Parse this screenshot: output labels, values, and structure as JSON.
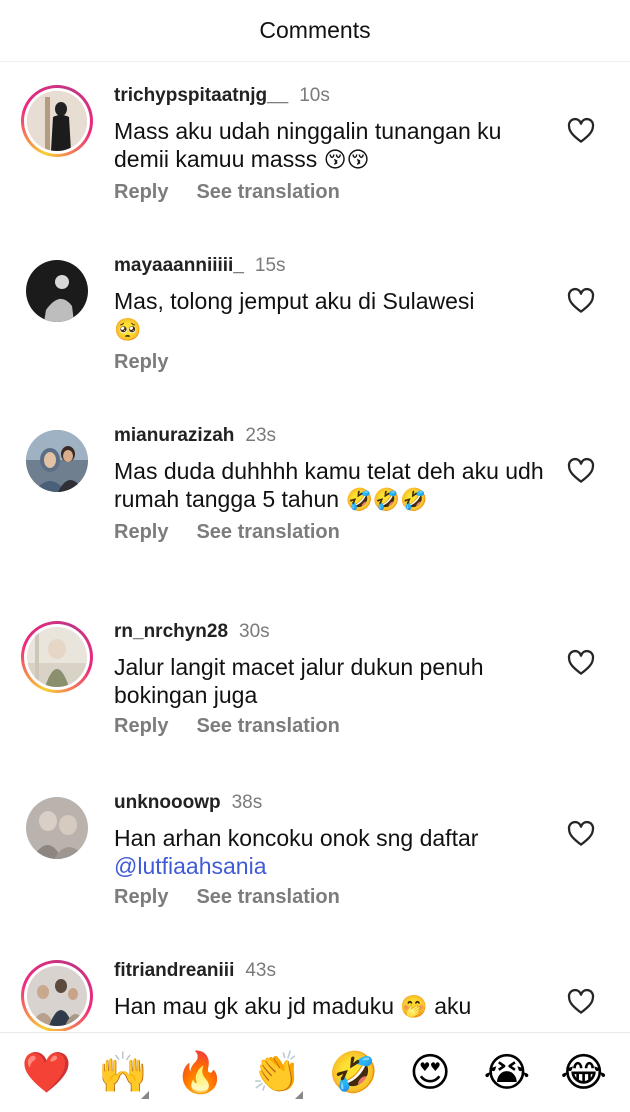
{
  "header": {
    "title": "Comments"
  },
  "comments": [
    {
      "username": "trichypspitaatnjg__",
      "time": "10s",
      "text": "Mass aku udah ninggalin tunangan ku demii kamuu masss",
      "emojis": "😚😚",
      "reply": "Reply",
      "translate": "See translation"
    },
    {
      "username": "mayaaanniiiii_",
      "time": "15s",
      "text": "Mas, tolong jemput aku di Sulawesi",
      "emojis": "🥺",
      "reply": "Reply"
    },
    {
      "username": "mianurazizah",
      "time": "23s",
      "text": "Mas duda duhhhh kamu telat deh aku udh rumah tangga 5 tahun",
      "emojis": "🤣🤣🤣",
      "reply": "Reply",
      "translate": "See translation"
    },
    {
      "username": "rn_nrchyn28",
      "time": "30s",
      "text": "Jalur langit macet jalur dukun penuh bokingan juga",
      "reply": "Reply",
      "translate": "See translation"
    },
    {
      "username": "unknooowp",
      "time": "38s",
      "text": "Han arhan koncoku onok sng daftar",
      "mention": "@lutfiaahsania",
      "reply": "Reply",
      "translate": "See translation"
    },
    {
      "username": "fitriandreaniii",
      "time": "43s",
      "text": "Han mau gk aku jd maduku",
      "emojis": "🤭",
      "text_after": "aku"
    }
  ],
  "emoji_bar": [
    "❤️",
    "🙌",
    "🔥",
    "👏",
    "🤣",
    "😍",
    "😭",
    "😂"
  ],
  "icons": {
    "like": "heart-outline-icon"
  },
  "colors": {
    "mention": "#3f5bd6",
    "muted": "#7c7c7c"
  }
}
